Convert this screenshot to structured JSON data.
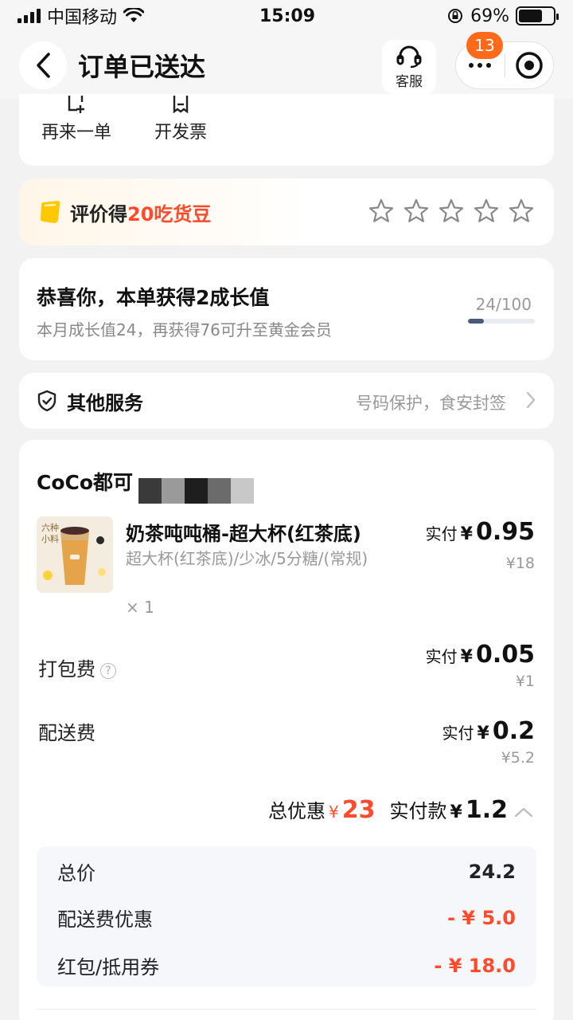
{
  "status_bar": {
    "carrier": "中国移动",
    "time": "15:09",
    "battery_percent": "69%",
    "battery_level": 0.69
  },
  "header": {
    "title": "订单已送达",
    "service_label": "客服",
    "notification_count": "13"
  },
  "actions": [
    {
      "label": "再来一单",
      "icon": "reorder-icon"
    },
    {
      "label": "开发票",
      "icon": "invoice-icon"
    }
  ],
  "review": {
    "prefix": "评价得",
    "highlight": "20吃货豆",
    "star_count": 5,
    "rating": 0
  },
  "growth": {
    "title": "恭喜你，本单获得2成长值",
    "subtitle": "本月成长值24，再获得76可升至黄金会员",
    "count": "24/100",
    "progress": 0.24
  },
  "services": {
    "title": "其他服务",
    "description": "号码保护，食安封签"
  },
  "order": {
    "shop_name": "CoCo都可",
    "product": {
      "name": "奶茶吨吨桶-超大杯(红茶底)",
      "spec": "超大杯(红茶底)/少冰/5分糖/(常规)",
      "qty": "× 1",
      "paid_label": "实付",
      "currency": "¥",
      "paid": "0.95",
      "original": "¥18",
      "image_text": "六种小料"
    },
    "packing": {
      "label": "打包费",
      "paid_label": "实付",
      "currency": "¥",
      "paid": "0.05",
      "original": "¥1"
    },
    "delivery": {
      "label": "配送费",
      "paid_label": "实付",
      "currency": "¥",
      "paid": "0.2",
      "original": "¥5.2"
    },
    "totals": {
      "discount_label": "总优惠",
      "discount_currency": "¥",
      "discount": "23",
      "paid_label": "实付款",
      "paid_currency": "¥",
      "paid": "1.2"
    },
    "breakdown": [
      {
        "label": "总价",
        "value": "24.2"
      },
      {
        "label": "配送费优惠",
        "value": "- ¥ 5.0"
      },
      {
        "label": "红包/抵用券",
        "value": "- ¥ 18.0"
      }
    ]
  },
  "colors": {
    "accent_red": "#ff4b2b",
    "badge_orange": "#ff6a1a",
    "coin_yellow": "#ffc800"
  }
}
